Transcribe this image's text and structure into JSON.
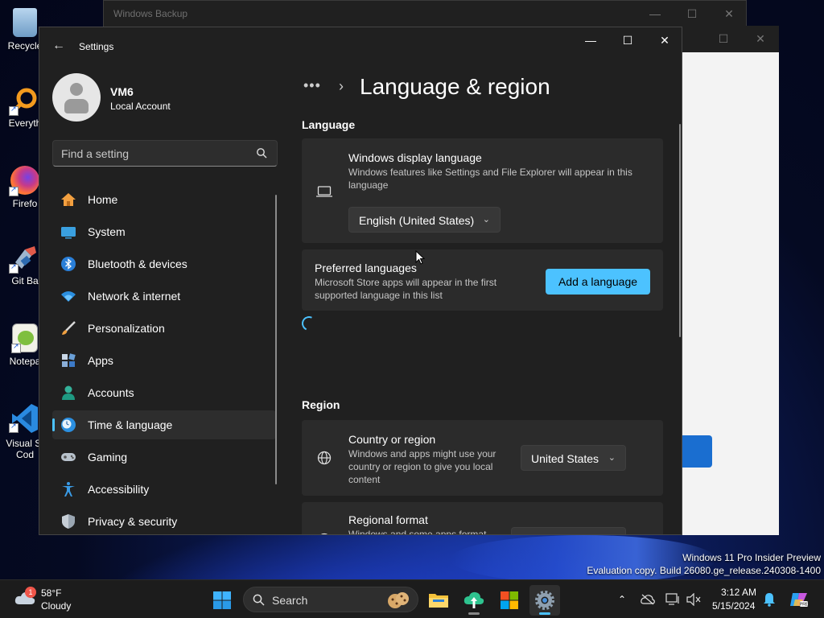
{
  "desktop": {
    "icons": [
      {
        "label": "Recycle",
        "icon": "recycle-bin-icon"
      },
      {
        "label": "Everyth",
        "icon": "everything-search-icon"
      },
      {
        "label": "Firefo",
        "icon": "firefox-icon"
      },
      {
        "label": "Git Ba",
        "icon": "git-bash-icon"
      },
      {
        "label": "Notepa",
        "icon": "notepad-plus-icon"
      },
      {
        "label": "Visual St",
        "label2": "Cod",
        "icon": "vscode-icon"
      }
    ]
  },
  "backup_window": {
    "title": "Windows Backup"
  },
  "settings": {
    "title": "Settings",
    "profile": {
      "name": "VM6",
      "account_type": "Local Account"
    },
    "search": {
      "placeholder": "Find a setting"
    },
    "nav": [
      {
        "label": "Home",
        "icon": "home-icon"
      },
      {
        "label": "System",
        "icon": "monitor-icon"
      },
      {
        "label": "Bluetooth & devices",
        "icon": "bluetooth-icon"
      },
      {
        "label": "Network & internet",
        "icon": "wifi-icon"
      },
      {
        "label": "Personalization",
        "icon": "brush-icon"
      },
      {
        "label": "Apps",
        "icon": "apps-icon"
      },
      {
        "label": "Accounts",
        "icon": "person-icon"
      },
      {
        "label": "Time & language",
        "icon": "clock-globe-icon",
        "active": true
      },
      {
        "label": "Gaming",
        "icon": "gamepad-icon"
      },
      {
        "label": "Accessibility",
        "icon": "accessibility-icon"
      },
      {
        "label": "Privacy & security",
        "icon": "shield-icon"
      }
    ],
    "breadcrumb": {
      "overflow": "•••",
      "current": "Language & region"
    },
    "language_section": {
      "heading": "Language",
      "display_language": {
        "title": "Windows display language",
        "desc1": "Windows features like Settings and File Explorer will appear in this",
        "desc2": "language",
        "value": "English (United States)"
      },
      "preferred": {
        "title": "Preferred languages",
        "desc1": "Microsoft Store apps will appear in the first",
        "desc2": "supported language in this list",
        "button": "Add a language"
      }
    },
    "region_section": {
      "heading": "Region",
      "country": {
        "title": "Country or region",
        "desc1": "Windows and apps might use your",
        "desc2": "country or region to give you local",
        "desc3": "content",
        "value": "United States"
      },
      "format": {
        "title": "Regional format",
        "desc1": "Windows and some apps format"
      }
    },
    "accent_color": "#4cc2ff"
  },
  "watermark": {
    "line1": "Windows 11 Pro Insider Preview",
    "line2": "Evaluation copy. Build 26080.ge_release.240308-1400"
  },
  "taskbar": {
    "weather": {
      "temp": "58°F",
      "condition": "Cloudy",
      "badge": "1"
    },
    "search_label": "Search",
    "clock": {
      "time": "3:12 AM",
      "date": "5/15/2024"
    }
  }
}
